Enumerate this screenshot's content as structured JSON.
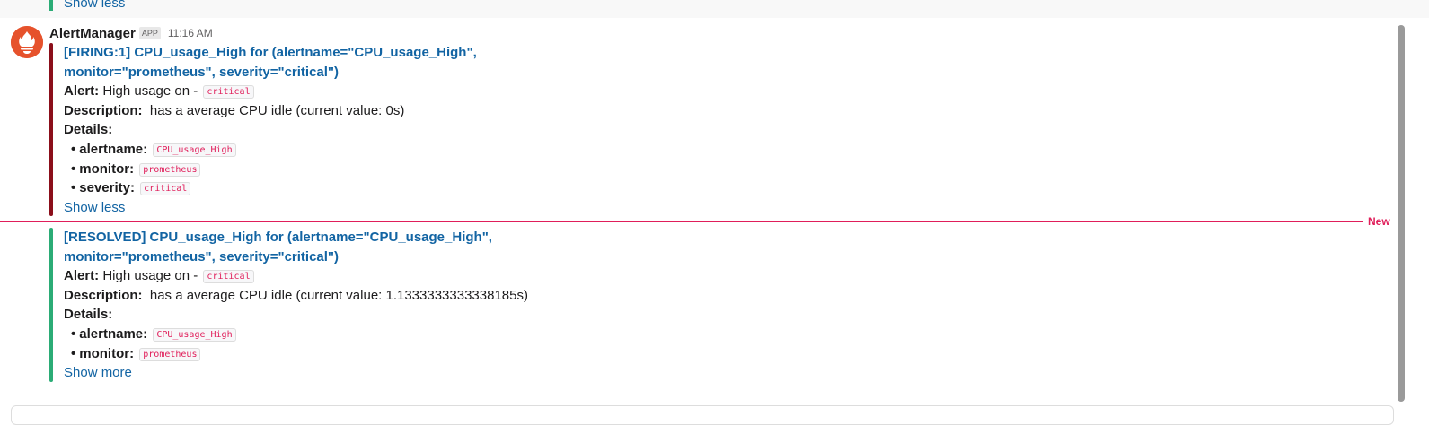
{
  "previous_message": {
    "toggle_label": "Show less",
    "bar_color": "#2bac76"
  },
  "message": {
    "sender": "AlertManager",
    "app_badge": "APP",
    "timestamp": "11:16 AM",
    "avatar_icon": "prometheus-flame-icon",
    "avatar_color": "#e6522c"
  },
  "attachments": [
    {
      "bar_color": "#8b0e1a",
      "title_line1": "[FIRING:1] CPU_usage_High for  (alertname=\"CPU_usage_High\",",
      "title_line2": "monitor=\"prometheus\", severity=\"critical\")",
      "alert_label": "Alert:",
      "alert_text": "High usage on  - ",
      "alert_code": "critical",
      "description_label": "Description:",
      "description_text": "has a average CPU idle (current value: 0s)",
      "details_label": "Details:",
      "details": [
        {
          "key": "alertname:",
          "value": "CPU_usage_High"
        },
        {
          "key": "monitor:",
          "value": "prometheus"
        },
        {
          "key": "severity:",
          "value": "critical"
        }
      ],
      "toggle_label": "Show less"
    },
    {
      "bar_color": "#2bac76",
      "title_line1": "[RESOLVED] CPU_usage_High for  (alertname=\"CPU_usage_High\",",
      "title_line2": "monitor=\"prometheus\", severity=\"critical\")",
      "alert_label": "Alert:",
      "alert_text": "High usage on  - ",
      "alert_code": "critical",
      "description_label": "Description:",
      "description_text": "has a average CPU idle (current value: 1.1333333333338185s)",
      "details_label": "Details:",
      "details": [
        {
          "key": "alertname:",
          "value": "CPU_usage_High"
        },
        {
          "key": "monitor:",
          "value": "prometheus"
        }
      ],
      "toggle_label": "Show more"
    }
  ],
  "divider": {
    "label": "New",
    "color": "#e01e5a"
  },
  "bullet": "•"
}
